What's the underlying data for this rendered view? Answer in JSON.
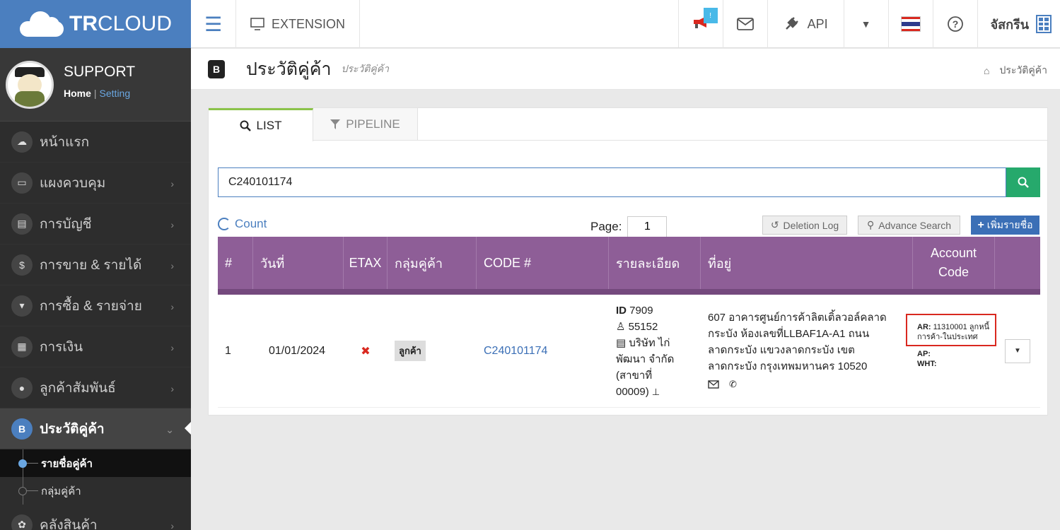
{
  "brand": {
    "bold": "TR",
    "rest": "CLOUD"
  },
  "profile": {
    "name": "SUPPORT",
    "home": "Home",
    "setting": "Setting"
  },
  "sidebar": {
    "items": [
      {
        "label": "หน้าแรก",
        "icon": "☁",
        "arrow": ""
      },
      {
        "label": "แผงควบคุม",
        "icon": "▭",
        "arrow": "›"
      },
      {
        "label": "การบัญชี",
        "icon": "▤",
        "arrow": "›"
      },
      {
        "label": "การขาย & รายได้",
        "icon": "$",
        "arrow": "›"
      },
      {
        "label": "การซื้อ & รายจ่าย",
        "icon": "▾",
        "arrow": "›"
      },
      {
        "label": "การเงิน",
        "icon": "▦",
        "arrow": "›"
      },
      {
        "label": "ลูกค้าสัมพันธ์",
        "icon": "●",
        "arrow": "›"
      },
      {
        "label": "ประวัติคู่ค้า",
        "icon": "B",
        "arrow": "⌄"
      }
    ],
    "sub_items": [
      {
        "label": "รายชื่อคู่ค้า"
      },
      {
        "label": "กลุ่มคู่ค้า"
      }
    ],
    "last_item": {
      "label": "คลังสินค้า",
      "icon": "✿",
      "arrow": "›"
    }
  },
  "topbar": {
    "extension": "EXTENSION",
    "notif_badge": "!",
    "api": "API",
    "user": "จัสกรีน"
  },
  "page": {
    "title": "ประวัติคู่ค้า",
    "subtitle": "ประวัติคู่ค้า",
    "breadcrumb": "ประวัติคู่ค้า"
  },
  "tabs": [
    {
      "label": "LIST",
      "icon": "⚲"
    },
    {
      "label": "PIPELINE",
      "icon": "▼"
    }
  ],
  "search": {
    "value": "C240101174"
  },
  "toolbar": {
    "count": "Count",
    "page_label": "Page:",
    "page_value": "1",
    "deletion_log": "Deletion Log",
    "advance_search": "Advance Search",
    "add": "เพิ่มรายชื่อ"
  },
  "table": {
    "headers": [
      "#",
      "วันที่",
      "ETAX",
      "กลุ่มคู่ค้า",
      "CODE #",
      "รายละเอียด",
      "ที่อยู่",
      "Account Code"
    ],
    "rows": [
      {
        "num": "1",
        "date": "01/01/2024",
        "etax": "✖",
        "group": "ลูกค้า",
        "code": "C240101174",
        "detail": {
          "id_label": "ID",
          "id": "7909",
          "user": "55152",
          "company": "บริษัท ไก่",
          "company2": "พัฒนา จำกัด",
          "branch": "(สาขาที่",
          "branch2": "00009)"
        },
        "address": [
          "607 อาคารศูนย์การค้าลิตเติ้ลวอล์คลาด",
          "กระบัง ห้องเลขที่LLBAF1A-A1 ถนน",
          "ลาดกระบัง แขวงลาดกระบัง เขต",
          "ลาดกระบัง กรุงเทพมหานคร 10520"
        ],
        "account": {
          "ar_label": "AR:",
          "ar": "11310001 ลูกหนี้การค้า-ในประเทศ",
          "ap_label": "AP:",
          "wht_label": "WHT:"
        }
      }
    ]
  },
  "colors": {
    "sidebar": "#2d2d2d",
    "brand_blue": "#4b7fbf",
    "table_header": "#8e5e97",
    "search_btn": "#26a96c",
    "highlight": "#d9281f"
  }
}
